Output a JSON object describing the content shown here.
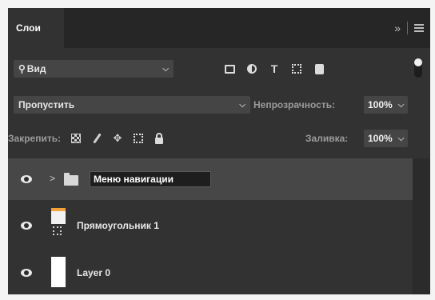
{
  "panel": {
    "tab_title": "Слои",
    "collapse_glyph": "»"
  },
  "filter": {
    "search_icon": "magnifier-icon",
    "kind_label": "Вид",
    "filter_icons": [
      "image-filter-icon",
      "adjustment-filter-icon",
      "type-filter-icon",
      "shape-filter-icon",
      "smart-object-filter-icon"
    ],
    "type_glyph": "T",
    "toggle_state": "on"
  },
  "blend": {
    "mode": "Пропустить",
    "opacity_label": "Непрозрачность:",
    "opacity_value": "100%"
  },
  "lock": {
    "label": "Закрепить:",
    "icons": [
      "lock-transparent-pixels-icon",
      "lock-image-pixels-icon",
      "lock-position-icon",
      "lock-artboard-icon",
      "lock-all-icon"
    ],
    "fill_label": "Заливка:",
    "fill_value": "100%"
  },
  "layers": [
    {
      "name": "Меню навигации",
      "type": "group",
      "visible": true,
      "selected": true,
      "editing": true
    },
    {
      "name": "Прямоугольник 1",
      "type": "shape",
      "visible": true,
      "selected": false
    },
    {
      "name": "Layer 0",
      "type": "pixel",
      "visible": true,
      "selected": false
    }
  ],
  "colors": {
    "panel_bg": "#323232",
    "header_bg": "#262626",
    "selected_row": "#474747",
    "thumb_accent": "#f4a43a"
  }
}
